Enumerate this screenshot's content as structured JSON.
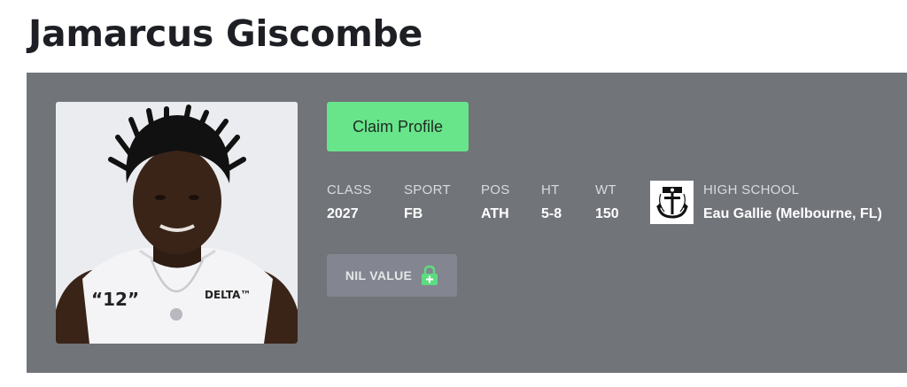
{
  "player": {
    "name": "Jamarcus Giscombe",
    "jersey_number": "“12”",
    "shirt_brand": "DELTA™"
  },
  "actions": {
    "claim_label": "Claim Profile",
    "nil_label": "NIL VALUE"
  },
  "stats": [
    {
      "label": "CLASS",
      "value": "2027"
    },
    {
      "label": "SPORT",
      "value": "FB"
    },
    {
      "label": "POS",
      "value": "ATH"
    },
    {
      "label": "HT",
      "value": "5-8"
    },
    {
      "label": "WT",
      "value": "150"
    }
  ],
  "school": {
    "label": "HIGH SCHOOL",
    "name": "Eau Gallie (Melbourne, FL)",
    "logo_icon": "anchor-icon"
  },
  "icons": {
    "nil_lock": "lock-plus-icon"
  },
  "colors": {
    "panel": "#717479",
    "claim_button": "#68e58b",
    "nil_button": "#838690",
    "lock": "#5ddc7f",
    "title": "#1d1f24"
  }
}
